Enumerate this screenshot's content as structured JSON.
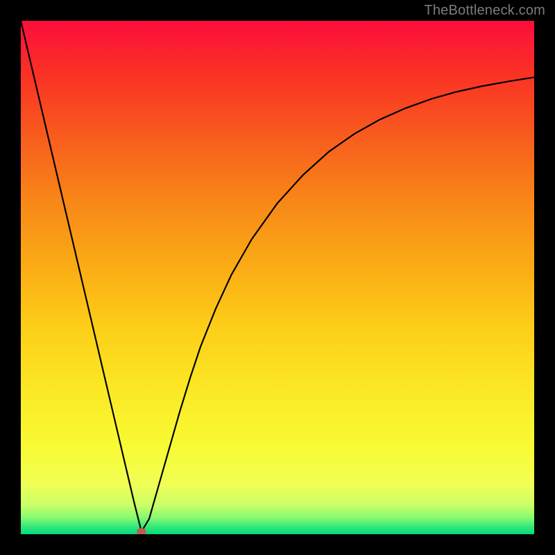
{
  "watermark": "TheBottleneck.com",
  "chart_data": {
    "type": "line",
    "title": "",
    "xlabel": "",
    "ylabel": "",
    "xlim": [
      0,
      100
    ],
    "ylim": [
      0,
      100
    ],
    "series": [
      {
        "name": "bottleneck-curve",
        "x": [
          0,
          2,
          4,
          6,
          8,
          10,
          12,
          14,
          16,
          18,
          20,
          22,
          23.5,
          25,
          27,
          29,
          31,
          33,
          35,
          38,
          41,
          45,
          50,
          55,
          60,
          65,
          70,
          75,
          80,
          85,
          90,
          95,
          100
        ],
        "y": [
          100,
          91.5,
          83,
          74.5,
          66,
          57.5,
          49,
          40.5,
          32,
          23.5,
          15,
          6.5,
          0.5,
          3,
          10,
          17,
          24,
          30.5,
          36.5,
          44,
          50.5,
          57.5,
          64.5,
          70,
          74.5,
          78,
          80.8,
          83,
          84.8,
          86.2,
          87.3,
          88.2,
          89
        ]
      }
    ],
    "gradient_stops": [
      {
        "offset": 0.0,
        "color": "#fd0d3d"
      },
      {
        "offset": 0.1,
        "color": "#fa3025"
      },
      {
        "offset": 0.22,
        "color": "#f85a1e"
      },
      {
        "offset": 0.35,
        "color": "#f88618"
      },
      {
        "offset": 0.48,
        "color": "#fbac15"
      },
      {
        "offset": 0.6,
        "color": "#fccf18"
      },
      {
        "offset": 0.72,
        "color": "#fbe825"
      },
      {
        "offset": 0.83,
        "color": "#f8fb34"
      },
      {
        "offset": 0.905,
        "color": "#f0ff56"
      },
      {
        "offset": 0.945,
        "color": "#c6ff68"
      },
      {
        "offset": 0.968,
        "color": "#86fa70"
      },
      {
        "offset": 0.985,
        "color": "#35e879"
      },
      {
        "offset": 1.0,
        "color": "#00db7f"
      }
    ],
    "marker": {
      "x": 23.5,
      "y": 0.5,
      "color": "#c15b51",
      "rx": 7,
      "ry": 5
    },
    "stroke": {
      "color": "#000000",
      "width": 2.2
    }
  }
}
